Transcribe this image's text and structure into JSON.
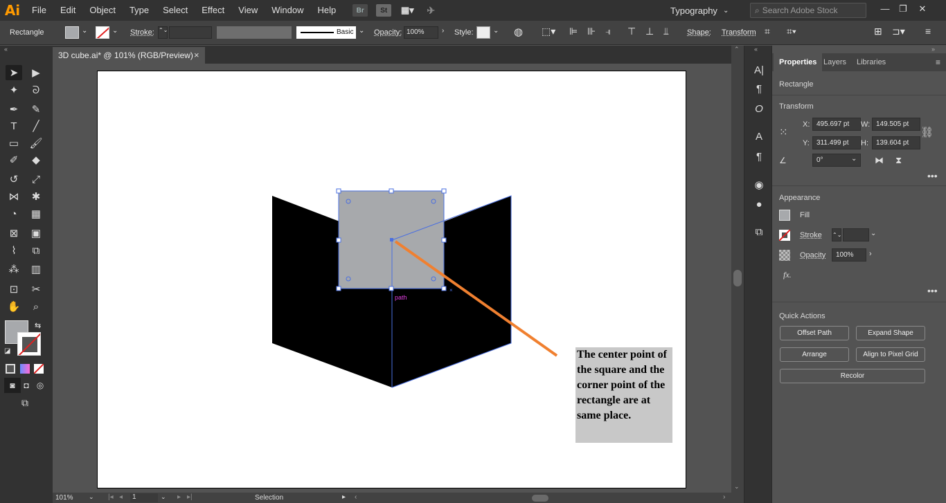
{
  "app": {
    "logo": "Ai"
  },
  "menu": [
    "File",
    "Edit",
    "Object",
    "Type",
    "Select",
    "Effect",
    "View",
    "Window",
    "Help"
  ],
  "menu_icons": {
    "bridge": "Br",
    "stock": "St"
  },
  "workspace": {
    "label": "Typography"
  },
  "search": {
    "placeholder": "Search Adobe Stock"
  },
  "control_bar": {
    "object_type": "Rectangle",
    "stroke_label": "Stroke:",
    "brush_label": "Basic",
    "opacity_label": "Opacity:",
    "opacity_value": "100%",
    "style_label": "Style:",
    "shape_label": "Shape:",
    "transform_label": "Transform"
  },
  "document": {
    "tab_title": "3D cube.ai* @ 101% (RGB/Preview)",
    "close": "×"
  },
  "canvas": {
    "path_label": "path",
    "annotation": "The center point of the square and the corner point of the rectangle are at same place."
  },
  "status_bar": {
    "zoom": "101%",
    "page": "1",
    "mode": "Selection"
  },
  "properties": {
    "tabs": [
      "Properties",
      "Layers",
      "Libraries"
    ],
    "object_type": "Rectangle",
    "transform": {
      "title": "Transform",
      "x_label": "X:",
      "x_value": "495.697 pt",
      "y_label": "Y:",
      "y_value": "311.499 pt",
      "w_label": "W:",
      "w_value": "149.505 pt",
      "h_label": "H:",
      "h_value": "139.604 pt",
      "angle_value": "0°"
    },
    "appearance": {
      "title": "Appearance",
      "fill_label": "Fill",
      "stroke_label": "Stroke",
      "opacity_label": "Opacity",
      "opacity_value": "100%",
      "fx_label": "fx."
    },
    "quick_actions": {
      "title": "Quick Actions",
      "offset_path": "Offset Path",
      "expand_shape": "Expand Shape",
      "arrange": "Arrange",
      "align_pixel": "Align to Pixel Grid",
      "recolor": "Recolor"
    }
  },
  "colors": {
    "accent_logo": "#ff9a00",
    "selection_blue": "#4a6fe0",
    "annotation_arrow": "#f08030",
    "square_fill": "#a7a9ac",
    "annotation_bg": "#c8c8c8"
  }
}
